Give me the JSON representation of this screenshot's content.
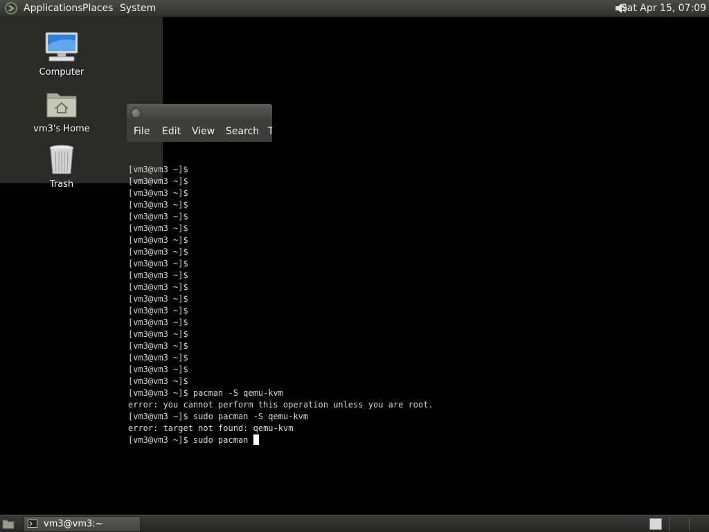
{
  "top_panel": {
    "menus": [
      "Applications",
      "Places",
      "System"
    ],
    "clock": "Sat Apr 15, 07:09",
    "volume_icon": "speaker-icon"
  },
  "desktop": {
    "icons": [
      {
        "label": "Computer",
        "icon": "computer-icon"
      },
      {
        "label": "vm3's Home",
        "icon": "home-folder-icon"
      },
      {
        "label": "Trash",
        "icon": "trash-icon"
      }
    ]
  },
  "terminal": {
    "menus": [
      "File",
      "Edit",
      "View",
      "Search",
      "T"
    ],
    "lines": [
      "[vm3@vm3 ~]$",
      "[vm3@vm3 ~]$",
      "[vm3@vm3 ~]$",
      "[vm3@vm3 ~]$",
      "[vm3@vm3 ~]$",
      "[vm3@vm3 ~]$",
      "[vm3@vm3 ~]$",
      "[vm3@vm3 ~]$",
      "[vm3@vm3 ~]$",
      "[vm3@vm3 ~]$",
      "[vm3@vm3 ~]$",
      "[vm3@vm3 ~]$",
      "[vm3@vm3 ~]$",
      "[vm3@vm3 ~]$",
      "[vm3@vm3 ~]$",
      "[vm3@vm3 ~]$",
      "[vm3@vm3 ~]$",
      "[vm3@vm3 ~]$",
      "[vm3@vm3 ~]$",
      "[vm3@vm3 ~]$ pacman -S qemu-kvm",
      "error: you cannot perform this operation unless you are root.",
      "[vm3@vm3 ~]$ sudo pacman -S qemu-kvm",
      "error: target not found: qemu-kvm"
    ],
    "current_line": "[vm3@vm3 ~]$ sudo pacman "
  },
  "bottom_panel": {
    "task_label": "vm3@vm3:~"
  }
}
